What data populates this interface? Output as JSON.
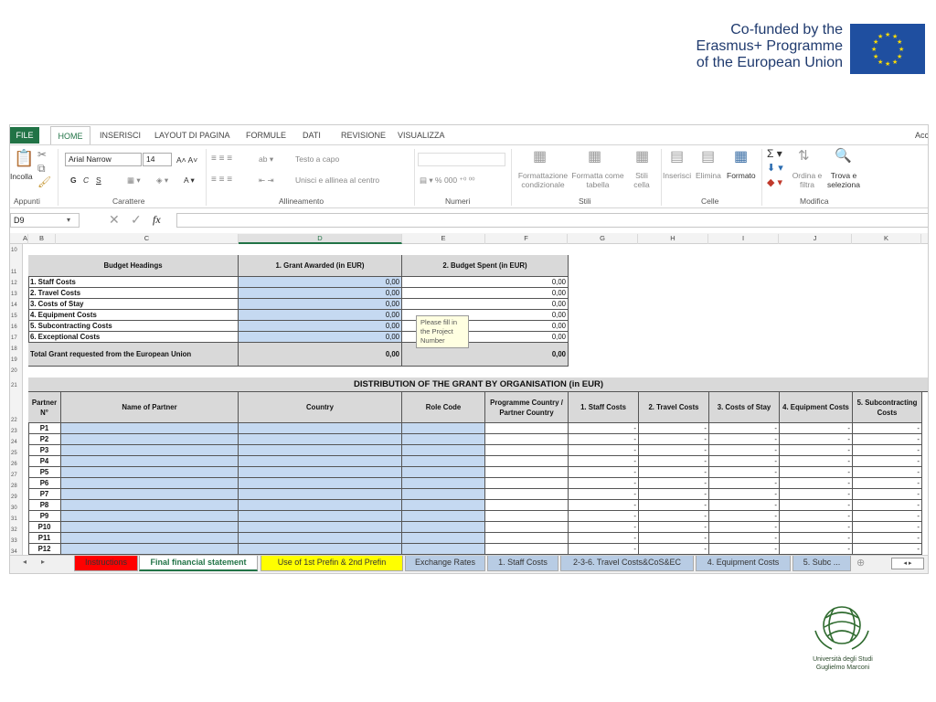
{
  "header": {
    "eu_line1": "Co-funded by the",
    "eu_line2": "Erasmus+ Programme",
    "eu_line3": "of the European Union",
    "university_line1": "Università degli Studi",
    "university_line2": "Guglielmo Marconi"
  },
  "menu": {
    "file": "FILE",
    "home": "HOME",
    "items": [
      "INSERISCI",
      "LAYOUT DI PAGINA",
      "FORMULE",
      "DATI",
      "REVISIONE",
      "VISUALIZZA"
    ],
    "account": "Acc"
  },
  "ribbon": {
    "paste": "Incolla",
    "font_name": "Arial Narrow",
    "font_size": "14",
    "bold": "G",
    "italic": "C",
    "underline": "S",
    "wrap_text": "Testo a capo",
    "merge_center": "Unisci e allinea al centro",
    "cond_format_1": "Formattazione",
    "cond_format_2": "condizionale",
    "format_table_1": "Formatta come",
    "format_table_2": "tabella",
    "cell_styles_1": "Stili",
    "cell_styles_2": "cella",
    "insert": "Inserisci",
    "delete": "Elimina",
    "format": "Formato",
    "sort_1": "Ordina e",
    "sort_2": "filtra",
    "find_1": "Trova e",
    "find_2": "seleziona",
    "groups": [
      "Appunti",
      "Carattere",
      "Allineamento",
      "Numeri",
      "Stili",
      "Celle",
      "Modifica"
    ]
  },
  "formula_bar": {
    "name_box": "D9",
    "fx": "fx",
    "value": ""
  },
  "columns": [
    "A",
    "B",
    "C",
    "D",
    "E",
    "F",
    "G",
    "H",
    "I",
    "J",
    "K"
  ],
  "rows": [
    "10",
    "11",
    "12",
    "13",
    "14",
    "15",
    "16",
    "17",
    "18",
    "19",
    "20",
    "21",
    "22",
    "23",
    "24",
    "25",
    "26",
    "27",
    "28",
    "29",
    "30",
    "31",
    "32",
    "33",
    "34"
  ],
  "budget": {
    "headers": [
      "Budget Headings",
      "1. Grant Awarded (in EUR)",
      "2. Budget Spent (in EUR)"
    ],
    "rows": [
      {
        "label": "1. Staff Costs",
        "awarded": "0,00",
        "spent": "0,00"
      },
      {
        "label": "2. Travel Costs",
        "awarded": "0,00",
        "spent": "0,00"
      },
      {
        "label": "3. Costs of Stay",
        "awarded": "0,00",
        "spent": "0,00"
      },
      {
        "label": "4. Equipment Costs",
        "awarded": "0,00",
        "spent": "0,00"
      },
      {
        "label": "5. Subcontracting Costs",
        "awarded": "0,00",
        "spent": "0,00"
      },
      {
        "label": "6. Exceptional Costs",
        "awarded": "0,00",
        "spent": "0,00"
      }
    ],
    "total_label": "Total Grant requested from the European Union",
    "total_awarded": "0,00",
    "total_spent": "0,00"
  },
  "tooltip": "Please fill in the Project Number",
  "distribution": {
    "title": "DISTRIBUTION OF THE GRANT BY ORGANISATION (in EUR)",
    "headers": [
      "Partner N°",
      "Name of Partner",
      "Country",
      "Role Code",
      "Programme Country / Partner Country",
      "1. Staff Costs",
      "2. Travel Costs",
      "3. Costs of Stay",
      "4. Equipment Costs",
      "5. Subcontracting Costs"
    ],
    "partners": [
      "P1",
      "P2",
      "P3",
      "P4",
      "P5",
      "P6",
      "P7",
      "P8",
      "P9",
      "P10",
      "P11",
      "P12"
    ],
    "dash": "-"
  },
  "sheet_tabs": [
    {
      "label": "Instructions",
      "color": "#ff0000"
    },
    {
      "label": "Final financial statement",
      "color": "#ffffff"
    },
    {
      "label": "Use of 1st Prefin & 2nd Prefin",
      "color": "#ffff00"
    },
    {
      "label": "Exchange Rates",
      "color": "#b8cce4"
    },
    {
      "label": "1. Staff Costs",
      "color": "#b8cce4"
    },
    {
      "label": "2-3-6. Travel Costs&CoS&EC",
      "color": "#b8cce4"
    },
    {
      "label": "4. Equipment Costs",
      "color": "#b8cce4"
    },
    {
      "label": "5. Subc ...",
      "color": "#b8cce4"
    }
  ]
}
